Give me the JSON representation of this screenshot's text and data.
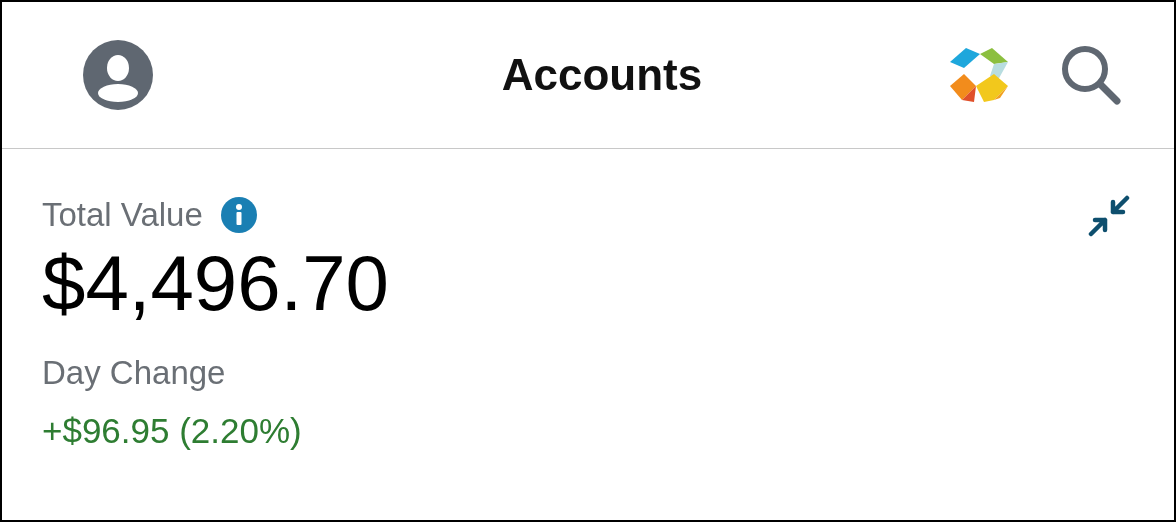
{
  "header": {
    "title": "Accounts"
  },
  "summary": {
    "total_label": "Total Value",
    "total_value": "$4,496.70",
    "day_change_label": "Day Change",
    "day_change_value": "+$96.95 (2.20%)"
  }
}
